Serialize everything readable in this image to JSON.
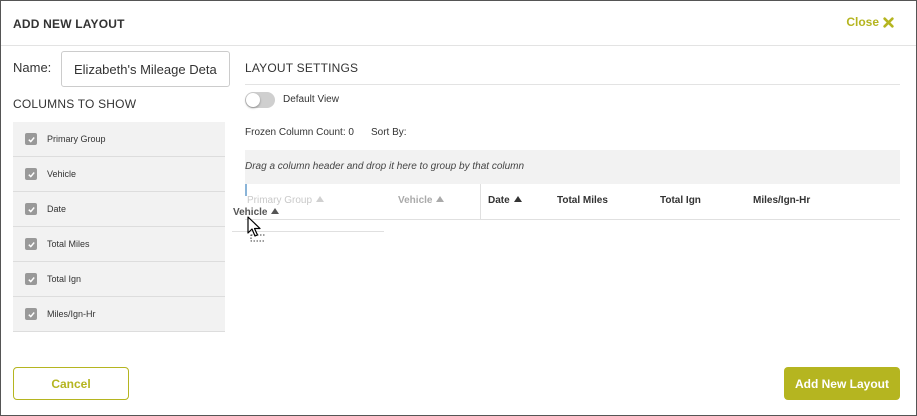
{
  "dialog": {
    "title": "ADD NEW LAYOUT",
    "close_label": "Close",
    "close_icon": "close-x-icon",
    "accent_color": "#b5b520"
  },
  "left": {
    "name_label": "Name:",
    "name_value": "Elizabeth's Mileage Detai",
    "columns_title": "COLUMNS TO SHOW",
    "columns": [
      {
        "label": "Primary Group",
        "checked": true
      },
      {
        "label": "Vehicle",
        "checked": true
      },
      {
        "label": "Date",
        "checked": true
      },
      {
        "label": "Total Miles",
        "checked": true
      },
      {
        "label": "Total Ign",
        "checked": true
      },
      {
        "label": "Miles/Ign-Hr",
        "checked": true
      }
    ]
  },
  "settings": {
    "title": "LAYOUT SETTINGS",
    "default_view_label": "Default View",
    "default_view_on": false,
    "frozen_label": "Frozen Column Count: 0",
    "sort_by_label": "Sort By:",
    "group_hint": "Drag a column header and drop it here to group by that column"
  },
  "grid": {
    "headers": [
      {
        "label": "Primary Group",
        "state": "ghost"
      },
      {
        "label": "Vehicle",
        "state": "dragging-source"
      },
      {
        "label": "Date",
        "state": "normal"
      },
      {
        "label": "Total Miles",
        "state": "normal"
      },
      {
        "label": "Total Ign",
        "state": "normal"
      },
      {
        "label": "Miles/Ign-Hr",
        "state": "normal"
      }
    ],
    "drag_ghost_label": "Vehicle"
  },
  "footer": {
    "cancel_label": "Cancel",
    "add_label": "Add New Layout"
  }
}
